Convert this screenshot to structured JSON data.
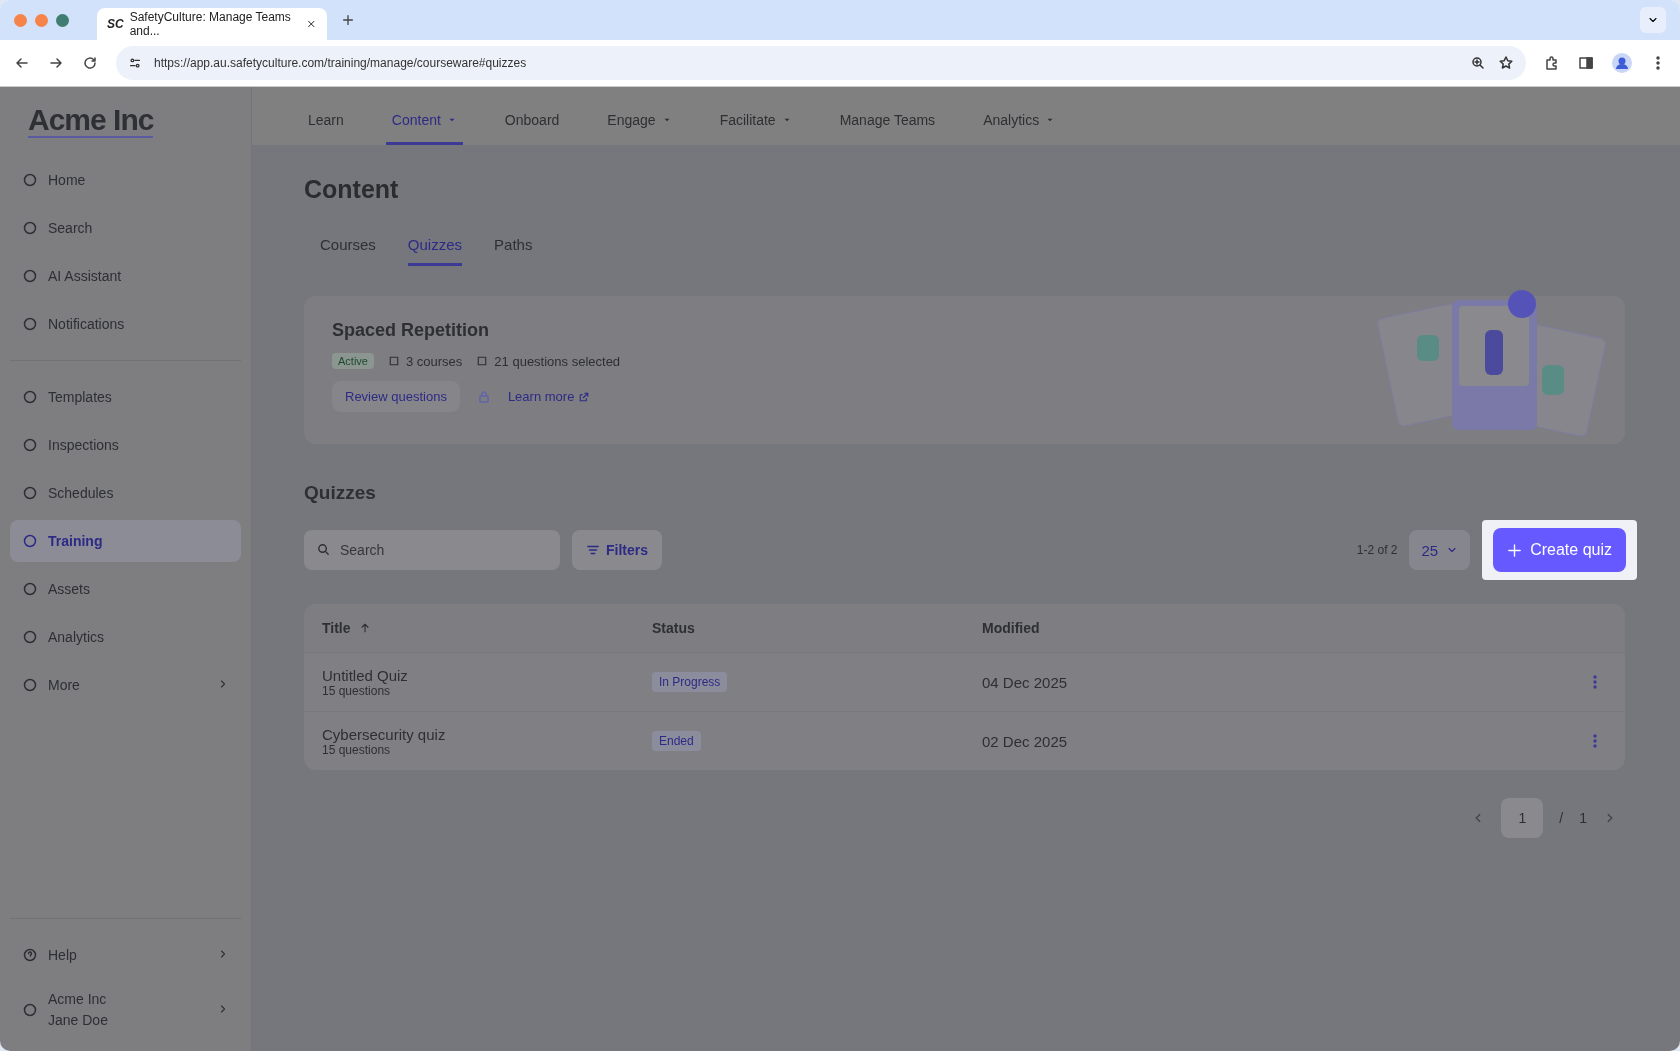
{
  "browser": {
    "site_icon": "SC",
    "tab_title": "SafetyCulture: Manage Teams and...",
    "url": "https://app.au.safetyculture.com/training/manage/courseware#quizzes"
  },
  "sidebar": {
    "logo": "Acme Inc",
    "items": [
      {
        "label": "Home",
        "selected": false
      },
      {
        "label": "Search",
        "selected": false
      },
      {
        "label": "AI Assistant",
        "selected": false
      },
      {
        "label": "Notifications",
        "selected": false
      }
    ],
    "items_2": [
      {
        "label": "Templates",
        "selected": false
      },
      {
        "label": "Inspections",
        "selected": false
      },
      {
        "label": "Schedules",
        "selected": false
      },
      {
        "label": "Training",
        "selected": true
      },
      {
        "label": "Assets",
        "selected": false
      },
      {
        "label": "Analytics",
        "selected": false
      },
      {
        "label": "More",
        "selected": false
      }
    ],
    "help": "Help",
    "account": {
      "org": "Acme Inc",
      "user": "Jane Doe"
    }
  },
  "top_nav": [
    {
      "label": "Learn",
      "selected": false,
      "dropdown": false
    },
    {
      "label": "Content",
      "selected": true,
      "dropdown": true
    },
    {
      "label": "Onboard",
      "selected": false,
      "dropdown": false
    },
    {
      "label": "Engage",
      "selected": false,
      "dropdown": true
    },
    {
      "label": "Facilitate",
      "selected": false,
      "dropdown": true
    },
    {
      "label": "Manage Teams",
      "selected": false,
      "dropdown": false
    },
    {
      "label": "Analytics",
      "selected": false,
      "dropdown": true
    }
  ],
  "title": "Content",
  "tabs": [
    {
      "label": "Courses",
      "selected": false
    },
    {
      "label": "Quizzes",
      "selected": true
    },
    {
      "label": "Paths",
      "selected": false
    }
  ],
  "spaced_card": {
    "title": "Spaced Repetition",
    "status": "Active",
    "courses": "3 courses",
    "questions": "21 questions selected",
    "review_button": "Review questions",
    "learn_link": "Learn more"
  },
  "quizzes": {
    "heading": "Quizzes",
    "search": {
      "placeholder": "Search"
    },
    "filters": "Filters",
    "range": "1-2 of 2",
    "page_size": "25",
    "create_button": "Create quiz",
    "columns": [
      "Title",
      "Status",
      "Modified"
    ],
    "rows": [
      {
        "title": "Untitled Quiz",
        "subtitle": "15 questions",
        "status": "In Progress",
        "modified": "04 Dec 2025"
      },
      {
        "title": "Cybersecurity quiz",
        "subtitle": "15 questions",
        "status": "Ended",
        "modified": "02 Dec 2025"
      }
    ],
    "pagination": {
      "page": "1",
      "separator": "/",
      "total": "1"
    }
  }
}
